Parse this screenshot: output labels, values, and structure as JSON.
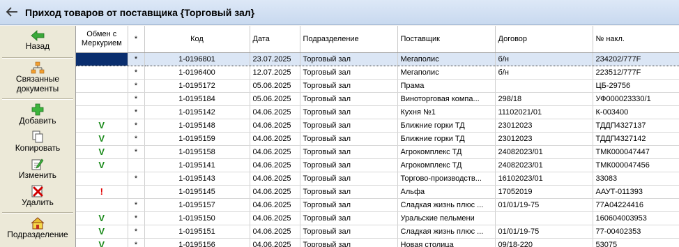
{
  "window": {
    "title": "Приход товаров от поставщика {Торговый зал}"
  },
  "colors": {
    "title_bg": "#c8d9ef",
    "selected_cell": "#0a2e6e",
    "selected_row": "#dbe6f5",
    "check_green": "#1a8a1a",
    "alert_red": "#e00000"
  },
  "sidebar": {
    "back": {
      "label": "Назад",
      "icon": "green-arrow-left-icon"
    },
    "related": {
      "label_line1": "Связанные",
      "label_line2": "документы",
      "icon": "org-chart-icon"
    },
    "add": {
      "label": "Добавить",
      "icon": "green-plus-icon"
    },
    "copy": {
      "label": "Копировать",
      "icon": "copy-pages-icon"
    },
    "edit": {
      "label": "Изменить",
      "icon": "edit-pencil-icon"
    },
    "delete": {
      "label": "Удалить",
      "icon": "delete-x-icon"
    },
    "division": {
      "label": "Подразделение",
      "icon": "house-icon"
    }
  },
  "table": {
    "headers": {
      "exchange": "Обмен с Меркурием",
      "star": "*",
      "code": "Код",
      "date": "Дата",
      "division": "Подразделение",
      "supplier": "Поставщик",
      "contract": "Договор",
      "invoice": "№ накл."
    },
    "rows": [
      {
        "exchange": "",
        "star": "*",
        "code": "1-0196801",
        "date": "23.07.2025",
        "division": "Торговый зал",
        "supplier": "Мегаполис",
        "contract": "б/н",
        "invoice": "234202/777F"
      },
      {
        "exchange": "",
        "star": "*",
        "code": "1-0196400",
        "date": "12.07.2025",
        "division": "Торговый зал",
        "supplier": "Мегаполис",
        "contract": "б/н",
        "invoice": "223512/777F"
      },
      {
        "exchange": "",
        "star": "*",
        "code": "1-0195172",
        "date": "05.06.2025",
        "division": "Торговый зал",
        "supplier": "Прама",
        "contract": "",
        "invoice": "ЦБ-29756"
      },
      {
        "exchange": "",
        "star": "*",
        "code": "1-0195184",
        "date": "05.06.2025",
        "division": "Торговый зал",
        "supplier": "Виноторговая компа...",
        "contract": "298/18",
        "invoice": "УФ000023330/1"
      },
      {
        "exchange": "",
        "star": "*",
        "code": "1-0195142",
        "date": "04.06.2025",
        "division": "Торговый зал",
        "supplier": "Кухня №1",
        "contract": "11102021/01",
        "invoice": "К-003400"
      },
      {
        "exchange": "V",
        "star": "*",
        "code": "1-0195148",
        "date": "04.06.2025",
        "division": "Торговый зал",
        "supplier": "Ближние горки ТД",
        "contract": "23012023",
        "invoice": "ТДДП4327137"
      },
      {
        "exchange": "V",
        "star": "*",
        "code": "1-0195159",
        "date": "04.06.2025",
        "division": "Торговый зал",
        "supplier": "Ближние горки ТД",
        "contract": "23012023",
        "invoice": "ТДДП4327142"
      },
      {
        "exchange": "V",
        "star": "*",
        "code": "1-0195158",
        "date": "04.06.2025",
        "division": "Торговый зал",
        "supplier": "Агрокомплекс ТД",
        "contract": "24082023/01",
        "invoice": "ТМК000047447"
      },
      {
        "exchange": "V",
        "star": "",
        "code": "1-0195141",
        "date": "04.06.2025",
        "division": "Торговый зал",
        "supplier": "Агрокомплекс ТД",
        "contract": "24082023/01",
        "invoice": "ТМК000047456"
      },
      {
        "exchange": "",
        "star": "*",
        "code": "1-0195143",
        "date": "04.06.2025",
        "division": "Торговый зал",
        "supplier": "Торгово-производств...",
        "contract": "16102023/01",
        "invoice": "33083"
      },
      {
        "exchange": "!",
        "star": "",
        "code": "1-0195145",
        "date": "04.06.2025",
        "division": "Торговый зал",
        "supplier": "Альфа",
        "contract": "17052019",
        "invoice": "ААУТ-011393"
      },
      {
        "exchange": "",
        "star": "*",
        "code": "1-0195157",
        "date": "04.06.2025",
        "division": "Торговый зал",
        "supplier": "Сладкая жизнь плюс ...",
        "contract": "01/01/19-75",
        "invoice": "77А04224416"
      },
      {
        "exchange": "V",
        "star": "*",
        "code": "1-0195150",
        "date": "04.06.2025",
        "division": "Торговый зал",
        "supplier": "Уральские пельмени",
        "contract": "",
        "invoice": "160604003953"
      },
      {
        "exchange": "V",
        "star": "*",
        "code": "1-0195151",
        "date": "04.06.2025",
        "division": "Торговый зал",
        "supplier": "Сладкая жизнь плюс ...",
        "contract": "01/01/19-75",
        "invoice": "77-00402353"
      },
      {
        "exchange": "V",
        "star": "*",
        "code": "1-0195156",
        "date": "04.06.2025",
        "division": "Торговый зал",
        "supplier": "Новая столица",
        "contract": "09/18-220",
        "invoice": "53075"
      }
    ]
  }
}
